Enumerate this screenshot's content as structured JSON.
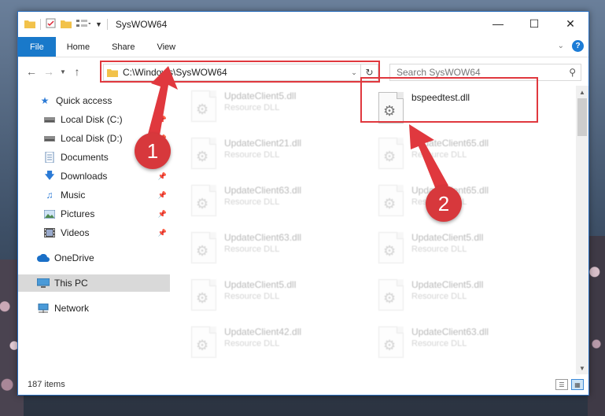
{
  "window": {
    "title": "SysWOW64"
  },
  "ribbon": {
    "tabs": [
      "File",
      "Home",
      "Share",
      "View"
    ]
  },
  "address": {
    "path": "C:\\Windows\\SysWOW64"
  },
  "search": {
    "placeholder": "Search SysWOW64"
  },
  "nav_pane": {
    "items": [
      {
        "label": "Quick access",
        "icon": "star-icon",
        "pinned": false,
        "selected": false
      },
      {
        "label": "Local Disk (C:)",
        "icon": "drive-icon",
        "pinned": true,
        "selected": false
      },
      {
        "label": "Local Disk (D:)",
        "icon": "drive-icon",
        "pinned": true,
        "selected": false
      },
      {
        "label": "Documents",
        "icon": "documents-icon",
        "pinned": true,
        "selected": false
      },
      {
        "label": "Downloads",
        "icon": "download-icon",
        "pinned": true,
        "selected": false
      },
      {
        "label": "Music",
        "icon": "music-icon",
        "pinned": true,
        "selected": false
      },
      {
        "label": "Pictures",
        "icon": "pictures-icon",
        "pinned": true,
        "selected": false
      },
      {
        "label": "Videos",
        "icon": "videos-icon",
        "pinned": true,
        "selected": false
      },
      {
        "label": "OneDrive",
        "icon": "cloud-icon",
        "pinned": false,
        "selected": false
      },
      {
        "label": "This PC",
        "icon": "computer-icon",
        "pinned": false,
        "selected": true
      },
      {
        "label": "Network",
        "icon": "network-icon",
        "pinned": false,
        "selected": false
      }
    ]
  },
  "files": {
    "highlighted": {
      "name": "bspeedtest.dll",
      "type": ""
    },
    "left_column": [
      {
        "name": "UpdateClient5.dll",
        "type": "Resource DLL"
      },
      {
        "name": "UpdateClient21.dll",
        "type": "Resource DLL"
      },
      {
        "name": "UpdateClient63.dll",
        "type": "Resource DLL"
      },
      {
        "name": "UpdateClient63.dll",
        "type": "Resource DLL"
      },
      {
        "name": "UpdateClient5.dll",
        "type": "Resource DLL"
      },
      {
        "name": "UpdateClient42.dll",
        "type": "Resource DLL"
      }
    ],
    "right_column": [
      {
        "name": "UpdateClient65.dll",
        "type": "Resource DLL"
      },
      {
        "name": "UpdateClient65.dll",
        "type": "Resource DLL"
      },
      {
        "name": "UpdateClient5.dll",
        "type": "Resource DLL"
      },
      {
        "name": "UpdateClient5.dll",
        "type": "Resource DLL"
      },
      {
        "name": "UpdateClient63.dll",
        "type": "Resource DLL"
      }
    ]
  },
  "status": {
    "items": "187 items"
  },
  "annotations": {
    "step1": "1",
    "step2": "2",
    "color": "#e0383e"
  }
}
